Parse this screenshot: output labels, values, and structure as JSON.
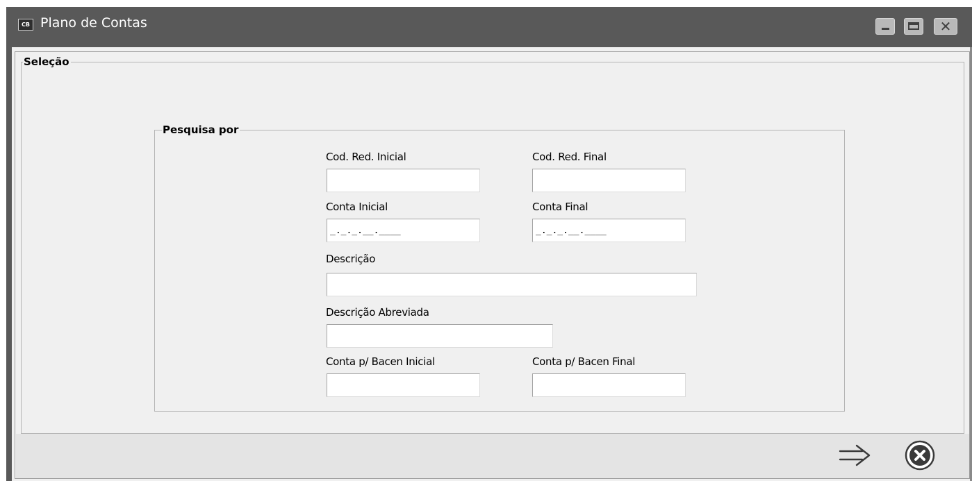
{
  "window": {
    "icon_text": "CB",
    "title": "Plano de Contas",
    "controls": {
      "minimize": "minimize-icon",
      "maximize": "maximize-icon",
      "close": "close-icon"
    }
  },
  "selecao": {
    "legend": "Seleção",
    "pesquisa": {
      "legend": "Pesquisa por",
      "fields": {
        "cod_red_inicial": {
          "label": "Cod. Red. Inicial",
          "value": ""
        },
        "cod_red_final": {
          "label": "Cod. Red. Final",
          "value": ""
        },
        "conta_inicial": {
          "label": "Conta Inicial",
          "value": "_._._.__.____"
        },
        "conta_final": {
          "label": "Conta Final",
          "value": "_._._.__.____"
        },
        "descricao": {
          "label": "Descrição",
          "value": ""
        },
        "descricao_abreviada": {
          "label": "Descrição Abreviada",
          "value": ""
        },
        "conta_bacen_inicial": {
          "label": "Conta p/ Bacen Inicial",
          "value": ""
        },
        "conta_bacen_final": {
          "label": "Conta p/ Bacen Final",
          "value": ""
        }
      }
    }
  },
  "footer": {
    "next_icon": "arrow-right-icon",
    "cancel_icon": "cancel-circle-icon"
  }
}
